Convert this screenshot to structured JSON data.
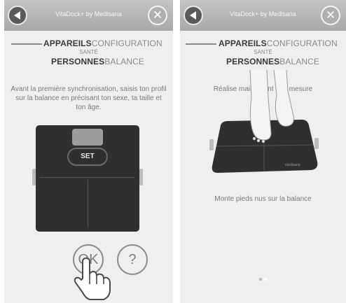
{
  "left": {
    "topbar": {
      "title": "VitaDock+ by Medisana"
    },
    "nav": {
      "bold1": "APPAREILS",
      "light1": "CONFIGURATION",
      "small": "SANTÉ",
      "bold2": "PERSONNES",
      "light2": "BALANCE"
    },
    "instruction": "Avant la première synchronisation, saisis ton profil sur la balance en précisant ton sexe, ta taille et ton âge.",
    "scale": {
      "set_label": "SET"
    },
    "buttons": {
      "ok": "OK",
      "help": "?"
    }
  },
  "right": {
    "topbar": {
      "title": "VitaDock+ by Medisana"
    },
    "nav": {
      "bold1": "APPAREILS",
      "light1": "CONFIGURATION",
      "small": "SANTÉ",
      "bold2": "PERSONNES",
      "light2": "BALANCE"
    },
    "instruction": "Réalise maintenant une mesure",
    "hint": "Monte pieds nus sur la balance",
    "scale_brand": "medisana",
    "pager": {
      "pages": 2,
      "current": 2
    }
  },
  "icons": {
    "back": "back-arrow-icon",
    "close": "close-icon",
    "pointer": "hand-pointer-icon",
    "feet": "feet-icon"
  },
  "colors": {
    "topbar": "#b8b8b8",
    "screen_bg": "#efefef",
    "scale": "#2f2f2f",
    "text": "#7b7b7b"
  }
}
